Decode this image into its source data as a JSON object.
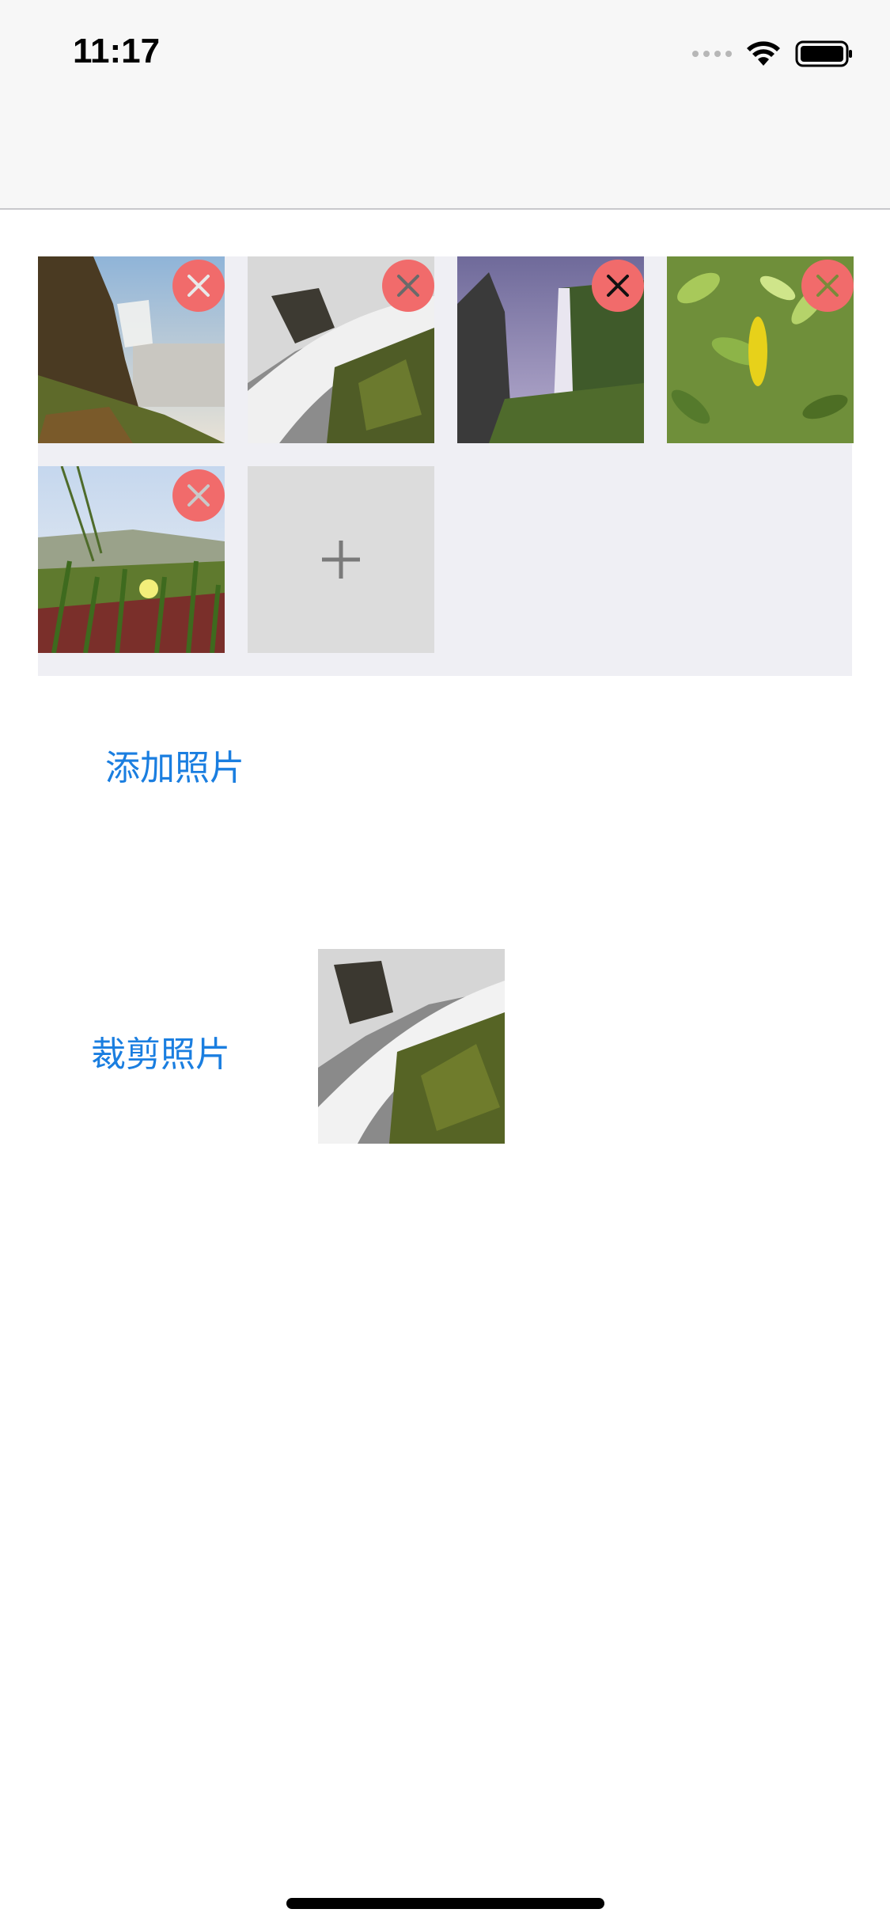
{
  "status_bar": {
    "time": "11:17",
    "icons": [
      "cellular-signal-icon",
      "wifi-icon",
      "battery-icon"
    ]
  },
  "photo_grid": {
    "photos": [
      {
        "name": "waterfall-cliff-photo",
        "description_icon": "photo"
      },
      {
        "name": "waterfall-rocks-photo",
        "description_icon": "photo"
      },
      {
        "name": "waterfall-valley-photo",
        "description_icon": "photo"
      },
      {
        "name": "green-leaves-photo",
        "description_icon": "photo"
      },
      {
        "name": "grass-flower-photo",
        "description_icon": "photo"
      }
    ],
    "delete_icon": "close-icon",
    "add_icon": "plus-icon"
  },
  "actions": {
    "add_photo": "添加照片",
    "crop_photo": "裁剪照片"
  },
  "colors": {
    "accent": "#1a7ee0",
    "delete_badge": "#f16b6b",
    "grid_background": "#efeff4",
    "add_tile": "#dcdcdc"
  }
}
